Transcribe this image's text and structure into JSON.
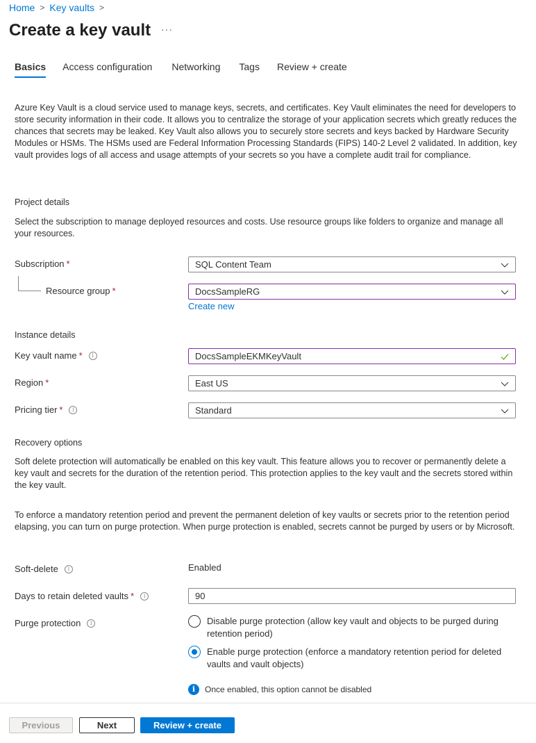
{
  "breadcrumb": [
    {
      "label": "Home"
    },
    {
      "label": "Key vaults"
    }
  ],
  "page": {
    "title": "Create a key vault",
    "more_label": "···"
  },
  "tabs": [
    {
      "label": "Basics",
      "active": true
    },
    {
      "label": "Access configuration"
    },
    {
      "label": "Networking"
    },
    {
      "label": "Tags"
    },
    {
      "label": "Review + create"
    }
  ],
  "intro": "Azure Key Vault is a cloud service used to manage keys, secrets, and certificates. Key Vault eliminates the need for developers to store security information in their code. It allows you to centralize the storage of your application secrets which greatly reduces the chances that secrets may be leaked. Key Vault also allows you to securely store secrets and keys backed by Hardware Security Modules or HSMs. The HSMs used are Federal Information Processing Standards (FIPS) 140-2 Level 2 validated. In addition, key vault provides logs of all access and usage attempts of your secrets so you have a complete audit trail for compliance.",
  "project": {
    "heading": "Project details",
    "description": "Select the subscription to manage deployed resources and costs. Use resource groups like folders to organize and manage all your resources.",
    "subscription": {
      "label": "Subscription",
      "value": "SQL Content Team"
    },
    "resource_group": {
      "label": "Resource group",
      "value": "DocsSampleRG",
      "create_new": "Create new"
    }
  },
  "instance": {
    "heading": "Instance details",
    "key_vault_name": {
      "label": "Key vault name",
      "value": "DocsSampleEKMKeyVault"
    },
    "region": {
      "label": "Region",
      "value": "East US"
    },
    "pricing_tier": {
      "label": "Pricing tier",
      "value": "Standard"
    }
  },
  "recovery": {
    "heading": "Recovery options",
    "soft_delete_text": "Soft delete protection will automatically be enabled on this key vault. This feature allows you to recover or permanently delete a key vault and secrets for the duration of the retention period. This protection applies to the key vault and the secrets stored within the key vault.",
    "purge_text": "To enforce a mandatory retention period and prevent the permanent deletion of key vaults or secrets prior to the retention period elapsing, you can turn on purge protection. When purge protection is enabled, secrets cannot be purged by users or by Microsoft.",
    "soft_delete": {
      "label": "Soft-delete",
      "value": "Enabled"
    },
    "days": {
      "label": "Days to retain deleted vaults",
      "value": "90"
    },
    "purge": {
      "label": "Purge protection",
      "options": [
        {
          "label": "Disable purge protection (allow key vault and objects to be purged during retention period)",
          "checked": false
        },
        {
          "label": "Enable purge protection (enforce a mandatory retention period for deleted vaults and vault objects)",
          "checked": true
        }
      ],
      "note": "Once enabled, this option cannot be disabled"
    }
  },
  "footer": {
    "previous": "Previous",
    "next": "Next",
    "review": "Review + create"
  },
  "colors": {
    "accent": "#0078d4",
    "focus_border": "#8a2da5",
    "required": "#a4262c",
    "valid": "#57a300"
  }
}
